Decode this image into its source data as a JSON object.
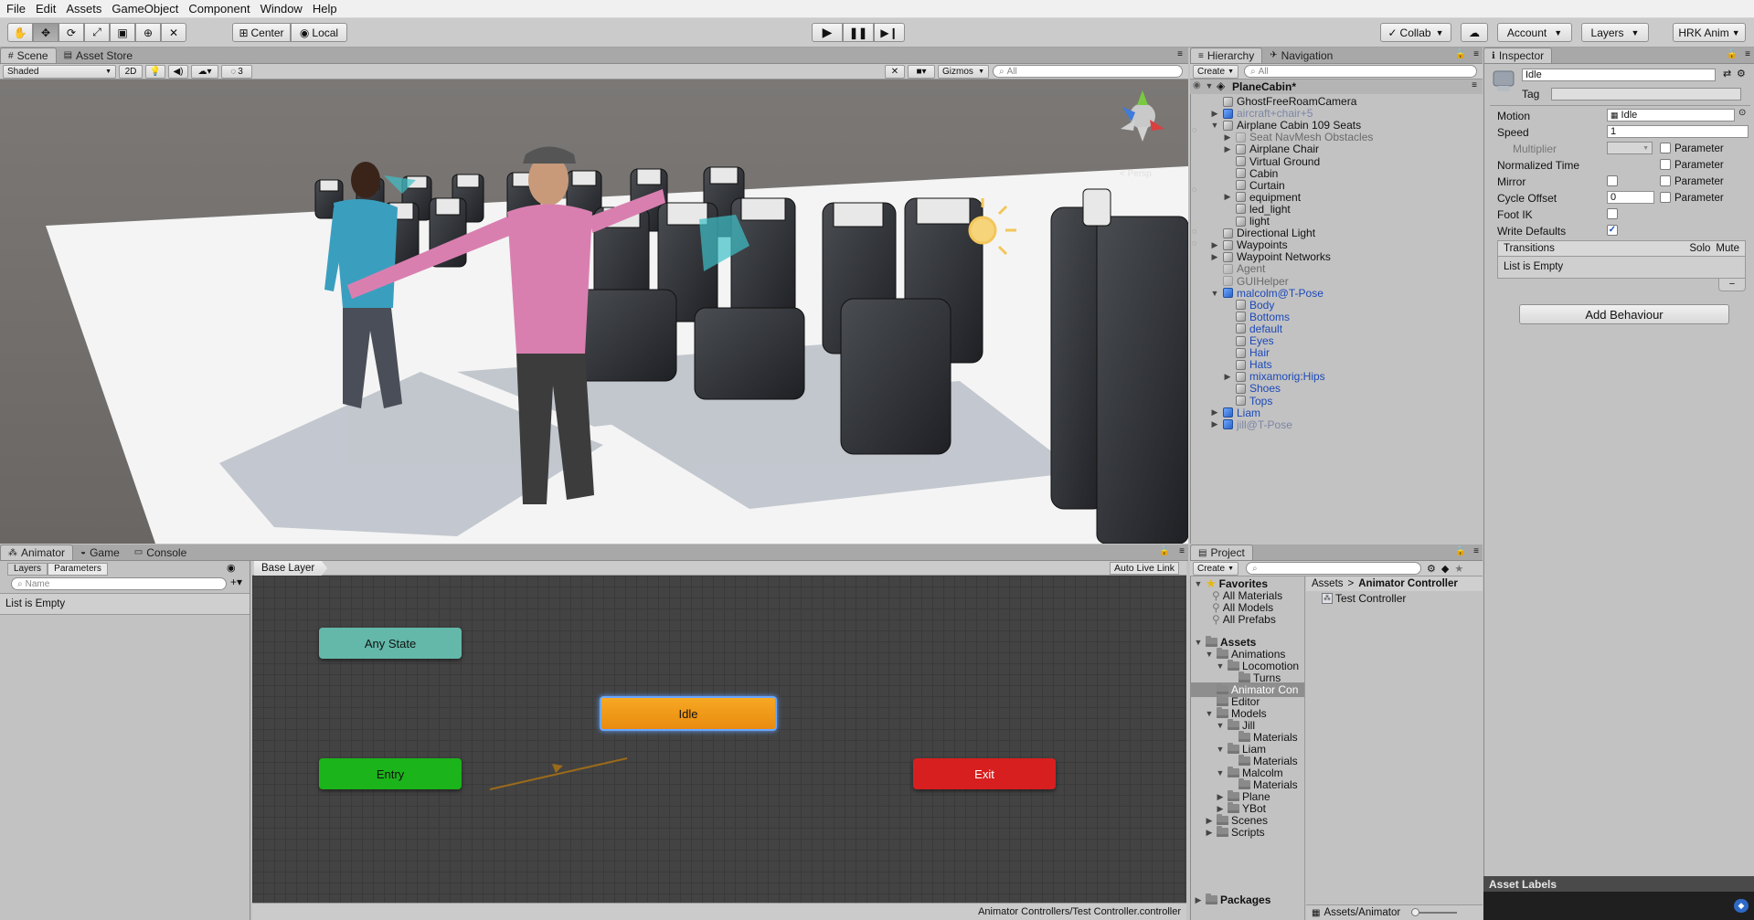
{
  "menu": [
    "File",
    "Edit",
    "Assets",
    "GameObject",
    "Component",
    "Window",
    "Help"
  ],
  "toolbar": {
    "pivot_center": "Center",
    "pivot_local": "Local",
    "collab": "Collab",
    "account": "Account",
    "layers": "Layers",
    "layout": "HRK Anim"
  },
  "scene": {
    "tabs": [
      "Scene",
      "Asset Store"
    ],
    "shading": "Shaded",
    "mode_2d": "2D",
    "hidden_count": "3",
    "gizmos": "Gizmos",
    "search_placeholder": "All",
    "persp_label": "< Persp"
  },
  "hierarchy": {
    "tabs": [
      "Hierarchy",
      "Navigation"
    ],
    "create": "Create",
    "search_placeholder": "All",
    "scene_name": "PlaneCabin*",
    "items": [
      {
        "label": "GhostFreeRoamCamera",
        "depth": 1,
        "arrow": "",
        "style": "normal"
      },
      {
        "label": "aircraft+chair+5",
        "depth": 1,
        "arrow": "▶",
        "style": "faded"
      },
      {
        "label": "Airplane Cabin 109 Seats",
        "depth": 1,
        "arrow": "▼",
        "style": "normal"
      },
      {
        "label": "Seat NavMesh Obstacles",
        "depth": 2,
        "arrow": "▶",
        "style": "dim"
      },
      {
        "label": "Airplane Chair",
        "depth": 2,
        "arrow": "▶",
        "style": "normal"
      },
      {
        "label": "Virtual Ground",
        "depth": 2,
        "arrow": "",
        "style": "normal"
      },
      {
        "label": "Cabin",
        "depth": 2,
        "arrow": "",
        "style": "normal"
      },
      {
        "label": "Curtain",
        "depth": 2,
        "arrow": "",
        "style": "normal"
      },
      {
        "label": "equipment",
        "depth": 2,
        "arrow": "▶",
        "style": "normal"
      },
      {
        "label": "led_light",
        "depth": 2,
        "arrow": "",
        "style": "normal"
      },
      {
        "label": "light",
        "depth": 2,
        "arrow": "",
        "style": "normal"
      },
      {
        "label": "Directional Light",
        "depth": 1,
        "arrow": "",
        "style": "normal"
      },
      {
        "label": "Waypoints",
        "depth": 1,
        "arrow": "▶",
        "style": "normal"
      },
      {
        "label": "Waypoint Networks",
        "depth": 1,
        "arrow": "▶",
        "style": "normal"
      },
      {
        "label": "Agent",
        "depth": 1,
        "arrow": "",
        "style": "dim"
      },
      {
        "label": "GUIHelper",
        "depth": 1,
        "arrow": "",
        "style": "dim"
      },
      {
        "label": "malcolm@T-Pose",
        "depth": 1,
        "arrow": "▼",
        "style": "blue"
      },
      {
        "label": "Body",
        "depth": 2,
        "arrow": "",
        "style": "blue"
      },
      {
        "label": "Bottoms",
        "depth": 2,
        "arrow": "",
        "style": "blue"
      },
      {
        "label": "default",
        "depth": 2,
        "arrow": "",
        "style": "blue"
      },
      {
        "label": "Eyes",
        "depth": 2,
        "arrow": "",
        "style": "blue"
      },
      {
        "label": "Hair",
        "depth": 2,
        "arrow": "",
        "style": "blue"
      },
      {
        "label": "Hats",
        "depth": 2,
        "arrow": "",
        "style": "blue"
      },
      {
        "label": "mixamorig:Hips",
        "depth": 2,
        "arrow": "▶",
        "style": "blue"
      },
      {
        "label": "Shoes",
        "depth": 2,
        "arrow": "",
        "style": "blue"
      },
      {
        "label": "Tops",
        "depth": 2,
        "arrow": "",
        "style": "blue"
      },
      {
        "label": "Liam",
        "depth": 1,
        "arrow": "▶",
        "style": "blue"
      },
      {
        "label": "jill@T-Pose",
        "depth": 1,
        "arrow": "▶",
        "style": "faded"
      }
    ]
  },
  "inspector": {
    "tab": "Inspector",
    "name": "Idle",
    "tag_label": "Tag",
    "motion_label": "Motion",
    "motion_value": "Idle",
    "speed_label": "Speed",
    "speed_value": "1",
    "multiplier_label": "Multiplier",
    "normalized_time_label": "Normalized Time",
    "mirror_label": "Mirror",
    "cycle_offset_label": "Cycle Offset",
    "cycle_offset_value": "0",
    "foot_ik_label": "Foot IK",
    "write_defaults_label": "Write Defaults",
    "parameter_label": "Parameter",
    "transitions_label": "Transitions",
    "solo_label": "Solo",
    "mute_label": "Mute",
    "list_empty": "List is Empty",
    "add_behaviour": "Add Behaviour",
    "asset_labels": "Asset Labels",
    "minus": "−"
  },
  "animator": {
    "tabs": [
      "Animator",
      "Game",
      "Console"
    ],
    "sub_tabs": [
      "Layers",
      "Parameters"
    ],
    "search_placeholder": "Name",
    "list_empty": "List is Empty",
    "breadcrumb": "Base Layer",
    "auto_live_link": "Auto Live Link",
    "footer_path": "Animator Controllers/Test Controller.controller",
    "nodes": {
      "any_state": "Any State",
      "idle": "Idle",
      "entry": "Entry",
      "exit": "Exit"
    },
    "colors": {
      "any_state": "#5fb8aa",
      "idle": "#f4a21e",
      "entry": "#1ab316",
      "exit": "#d81c1c"
    }
  },
  "project": {
    "tab": "Project",
    "create": "Create",
    "favorites_label": "Favorites",
    "favorites": [
      "All Materials",
      "All Models",
      "All Prefabs"
    ],
    "tree": [
      {
        "label": "Assets",
        "depth": 0,
        "arrow": "▼",
        "bold": true
      },
      {
        "label": "Animations",
        "depth": 1,
        "arrow": "▼"
      },
      {
        "label": "Locomotion",
        "depth": 2,
        "arrow": "▼"
      },
      {
        "label": "Turns",
        "depth": 3,
        "arrow": ""
      },
      {
        "label": "Animator Con",
        "depth": 1,
        "arrow": "",
        "selected": true
      },
      {
        "label": "Editor",
        "depth": 1,
        "arrow": ""
      },
      {
        "label": "Models",
        "depth": 1,
        "arrow": "▼"
      },
      {
        "label": "Jill",
        "depth": 2,
        "arrow": "▼"
      },
      {
        "label": "Materials",
        "depth": 3,
        "arrow": ""
      },
      {
        "label": "Liam",
        "depth": 2,
        "arrow": "▼"
      },
      {
        "label": "Materials",
        "depth": 3,
        "arrow": ""
      },
      {
        "label": "Malcolm",
        "depth": 2,
        "arrow": "▼"
      },
      {
        "label": "Materials",
        "depth": 3,
        "arrow": ""
      },
      {
        "label": "Plane",
        "depth": 2,
        "arrow": "▶"
      },
      {
        "label": "YBot",
        "depth": 2,
        "arrow": "▶"
      },
      {
        "label": "Scenes",
        "depth": 1,
        "arrow": "▶"
      },
      {
        "label": "Scripts",
        "depth": 1,
        "arrow": "▶"
      },
      {
        "label": "Packages",
        "depth": 0,
        "arrow": "▶",
        "bold": true
      }
    ],
    "breadcrumb_root": "Assets",
    "breadcrumb_sep": ">",
    "breadcrumb_current": "Animator Controller",
    "files": [
      "Test Controller"
    ],
    "footer_path": "Assets/Animator"
  }
}
